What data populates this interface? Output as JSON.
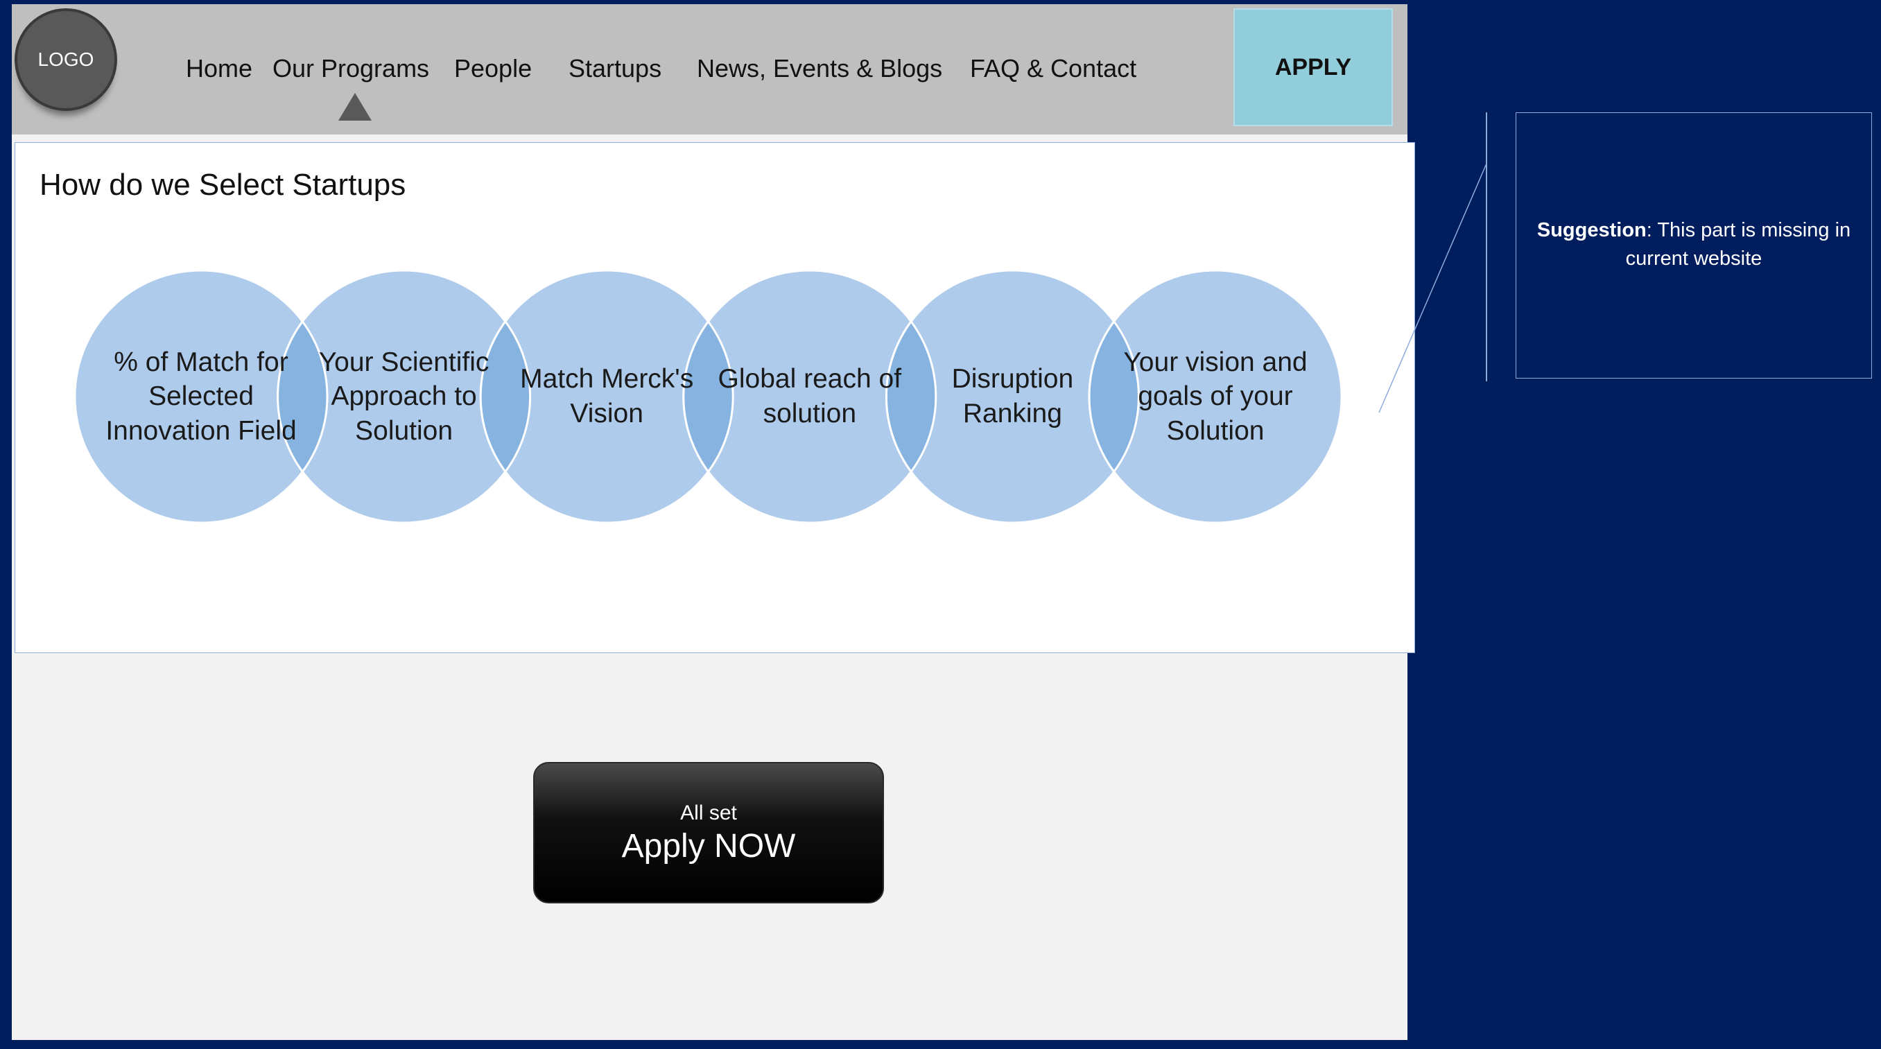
{
  "nav": {
    "logo": "LOGO",
    "items": [
      "Home",
      "Our Programs",
      "People",
      "Startups",
      "News, Events & Blogs",
      "FAQ & Contact"
    ],
    "apply": "APPLY"
  },
  "section": {
    "title": "How do we Select Startups",
    "criteria": [
      "% of Match for Selected Innovation Field",
      "Your Scientific Approach to Solution",
      "Match Merck's Vision",
      "Global reach of solution",
      "Disruption Ranking",
      "Your vision and goals of your Solution"
    ]
  },
  "cta": {
    "sub": "All set",
    "main": "Apply NOW"
  },
  "annotation": {
    "label": "Suggestion",
    "text": ": This part is missing in current website"
  },
  "colors": {
    "background": "#001e5e",
    "circle": "#aecbeb",
    "overlap": "#86b3df",
    "apply": "#92cddc"
  }
}
